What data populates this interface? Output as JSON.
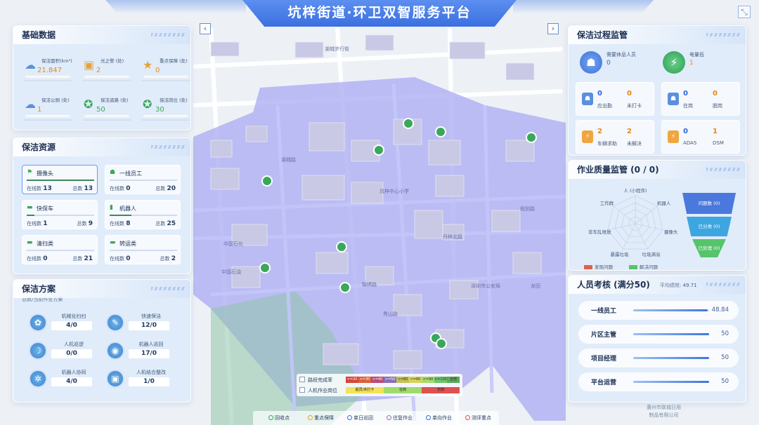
{
  "header": {
    "title": "坑梓街道·环卫双智服务平台",
    "nav_prev": "‹",
    "nav_next": "›",
    "expand": "⤡"
  },
  "map": {
    "labels": [
      "湖城步行街",
      "中国石化",
      "湖城路",
      "坑梓中心小学",
      "中国石油",
      "锦绣路",
      "丹梓北路",
      "秀山路",
      "龙田",
      "规划路",
      "深圳市公安局"
    ]
  },
  "basic": {
    "title": "基础数据",
    "items": [
      {
        "label": "保洁面积(km²)",
        "value": "21.847",
        "icon": "☁"
      },
      {
        "label": "光之警 (处)",
        "value": "2",
        "icon": "▣"
      },
      {
        "label": "重点保障 (处)",
        "value": "0",
        "icon": "★"
      },
      {
        "label": "保洁公厕 (处)",
        "value": "1",
        "icon": "☁"
      },
      {
        "label": "保洁道路 (处)",
        "value": "50",
        "icon": "✪"
      },
      {
        "label": "保洁岗位 (处)",
        "value": "30",
        "icon": "✪"
      }
    ]
  },
  "resources": {
    "title": "保洁资源",
    "online_label": "在线数",
    "total_label": "总数",
    "items": [
      {
        "name": "摄像头",
        "online": "13",
        "total": "13",
        "icon": "⚑",
        "fill": 1.0
      },
      {
        "name": "一线员工",
        "online": "0",
        "total": "20",
        "icon": "☗",
        "fill": 0.0
      },
      {
        "name": "快保车",
        "online": "1",
        "total": "9",
        "icon": "▬",
        "fill": 0.11
      },
      {
        "name": "机器人",
        "online": "8",
        "total": "25",
        "icon": "▮",
        "fill": 0.32
      },
      {
        "name": "清扫类",
        "online": "0",
        "total": "21",
        "icon": "▬",
        "fill": 0.0
      },
      {
        "name": "转运类",
        "online": "0",
        "total": "2",
        "icon": "▬",
        "fill": 0.0
      }
    ]
  },
  "scheme": {
    "title": "保洁方案",
    "subtitle": "总数/当前作业方案",
    "items": [
      {
        "label": "机械化扫扫",
        "value": "4/0",
        "icon": "✿"
      },
      {
        "label": "快速保洁",
        "value": "12/0",
        "icon": "✎"
      },
      {
        "label": "人机巡逻",
        "value": "0/0",
        "icon": "☽"
      },
      {
        "label": "机器人巡回",
        "value": "17/0",
        "icon": "◉"
      },
      {
        "label": "机器人协同",
        "value": "4/0",
        "icon": "✲"
      },
      {
        "label": "人机结合整改",
        "value": "1/0",
        "icon": "▣"
      }
    ]
  },
  "process": {
    "title": "保洁过程监管",
    "rest": {
      "label": "需要休息人员",
      "value": "0"
    },
    "battery": {
      "label": "电量低",
      "value": "1"
    },
    "boxes": [
      {
        "a": "0",
        "al": "应出勤",
        "b": "0",
        "bl": "未打卡",
        "ca": "#2c66d8",
        "cb": "#e08a1a",
        "ic": "#5a8fe0"
      },
      {
        "a": "0",
        "al": "在岗",
        "b": "0",
        "bl": "脱岗",
        "ca": "#2c66d8",
        "cb": "#e08a1a",
        "ic": "#5a8fe0"
      },
      {
        "a": "2",
        "al": "车辆求助",
        "b": "2",
        "bl": "未解决",
        "ca": "#e08a1a",
        "cb": "#e08a1a",
        "ic": "#f0a640"
      },
      {
        "a": "0",
        "al": "ADAS",
        "b": "1",
        "bl": "DSM",
        "ca": "#2c66d8",
        "cb": "#e08a1a",
        "ic": "#f0a640"
      }
    ]
  },
  "quality": {
    "title": "作业质量监管  (0 / 0)",
    "radar": [
      "人 (小程序)",
      "机器人",
      "摄像头",
      "垃圾满溢",
      "暴露垃圾",
      "非车乱堆放",
      "工作群"
    ],
    "funnel": [
      "问题数 (0)",
      "已分类 (0)",
      "已处理 (0)"
    ],
    "legend": [
      "发现问题",
      "解决问题"
    ]
  },
  "assess": {
    "title": "人员考核  (满分50)",
    "avg_label": "平均绩效:",
    "avg": "49.71",
    "rows": [
      {
        "name": "一线员工",
        "value": "48.84",
        "score": 48.84
      },
      {
        "name": "片区主管",
        "value": "50",
        "score": 50
      },
      {
        "name": "项目经理",
        "value": "50",
        "score": 50
      },
      {
        "name": "平台运营",
        "value": "50",
        "score": 50
      }
    ]
  },
  "map_legend": {
    "row1_label": "路段完成率",
    "row2_label": "人机作业岗位",
    "scale": [
      "<=20",
      "<=30",
      "<=40",
      "<=50",
      "<=60",
      "<=80",
      "<=90",
      "<=100",
      "全部"
    ],
    "scale_colors": [
      "#d9423b",
      "#d9603b",
      "#b94b7a",
      "#8a6fb5",
      "#c2c253",
      "#d7d456",
      "#a7d96a",
      "#6bc46a",
      "#5aaa5a"
    ],
    "status": [
      "超员/未打卡",
      "在岗",
      "无岗"
    ],
    "status_colors": [
      "#f3e25a",
      "#9fdb6b",
      "#e05050"
    ]
  },
  "bottom": {
    "items": [
      "回收点",
      "重点保障",
      "单日巡回",
      "往复作业",
      "单向作业",
      "测评重点"
    ]
  },
  "watermark": {
    "line1": "惠州市联城日用",
    "line2": "制品有限公司"
  }
}
